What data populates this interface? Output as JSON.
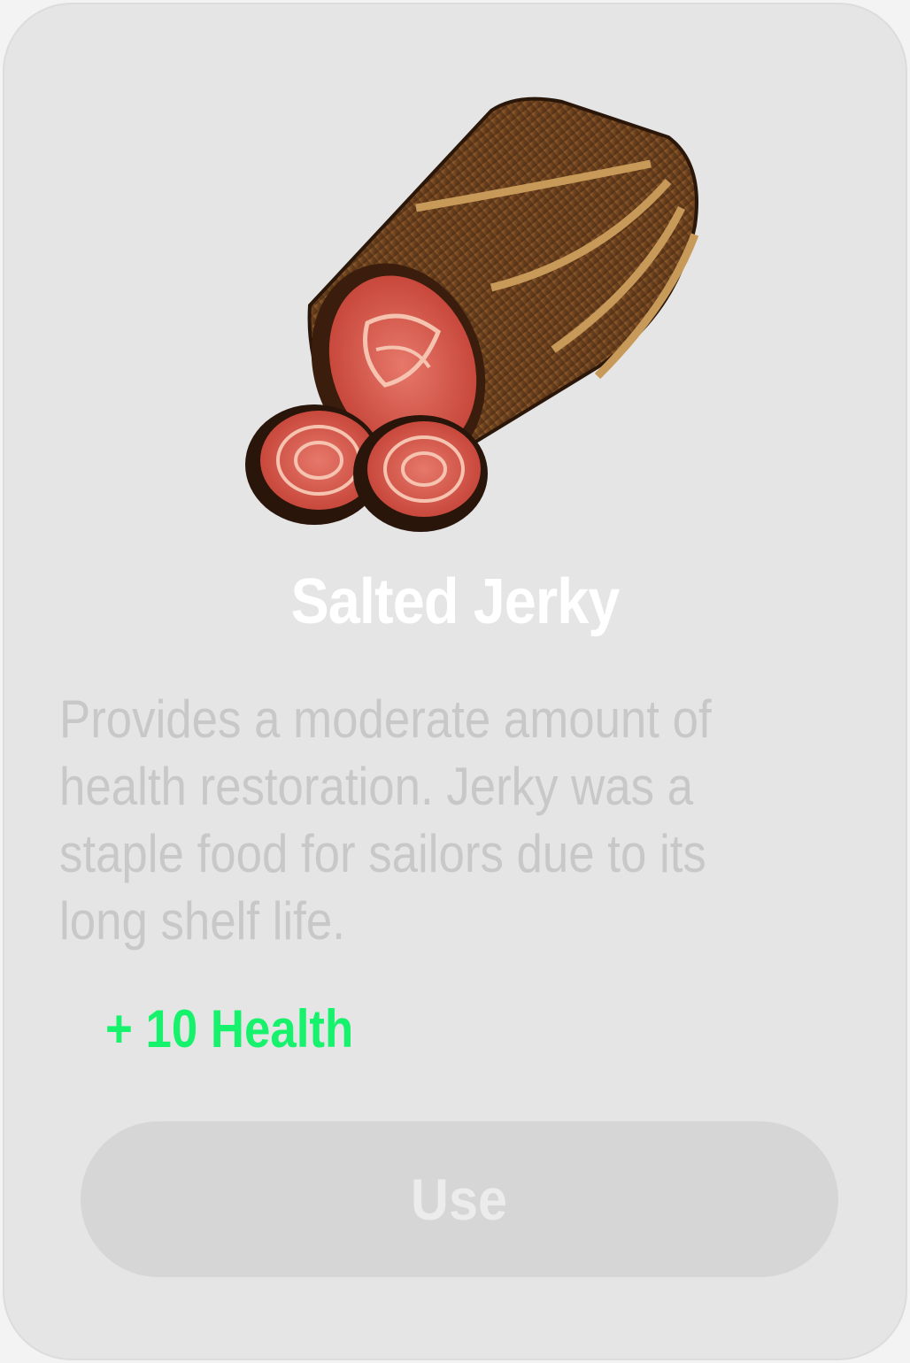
{
  "item": {
    "title": "Salted Jerky",
    "description": "Provides a moderate amount of\nhealth restoration. Jerky was a\nstaple food for sailors due to its\nlong shelf life.",
    "effect": "+ 10 Health",
    "image_icon": "salted-jerky-icon"
  },
  "actions": {
    "use_label": "Use"
  },
  "colors": {
    "card_background": "#e5e5e5",
    "title": "#ffffff",
    "description": "#c8c8c8",
    "effect": "#16f26c",
    "button_background": "#d6d6d6",
    "button_text": "#ececec"
  }
}
